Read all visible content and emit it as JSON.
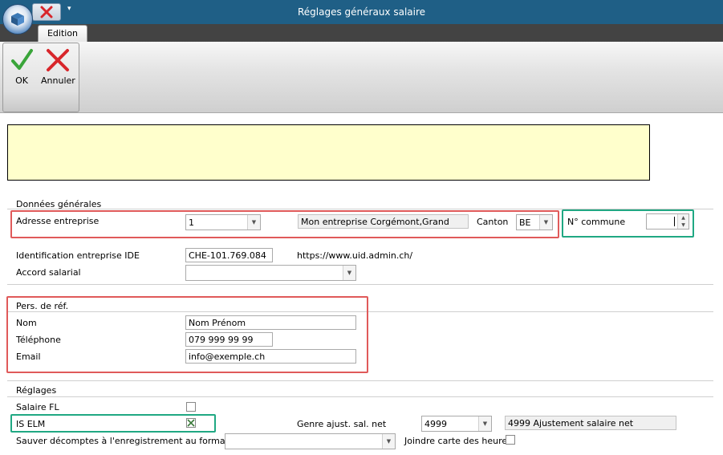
{
  "window": {
    "title": "Réglages généraux salaire"
  },
  "ribbon": {
    "tab_label": "Edition",
    "ok_label": "OK",
    "cancel_label": "Annuler"
  },
  "general": {
    "section_title": "Données générales",
    "company_address_label": "Adresse entreprise",
    "company_address_value": "1",
    "company_name": "Mon entreprise Corgémont,Grand",
    "canton_label": "Canton",
    "canton_value": "BE",
    "commune_label": "N° commune",
    "commune_value": "",
    "ide_label": "Identification entreprise IDE",
    "ide_value": "CHE-101.769.084",
    "ide_link": "https://www.uid.admin.ch/",
    "salary_agreement_label": "Accord salarial",
    "salary_agreement_value": ""
  },
  "reference_person": {
    "section_title": "Pers. de réf.",
    "name_label": "Nom",
    "name_value": "Nom Prénom",
    "phone_label": "Téléphone",
    "phone_value": "079 999 99 99",
    "email_label": "Email",
    "email_value": "info@exemple.ch"
  },
  "settings": {
    "section_title": "Réglages",
    "salaire_fl_label": "Salaire FL",
    "salaire_fl_checked": false,
    "is_elm_label": "IS ELM",
    "is_elm_checked": true,
    "adjust_type_label": "Genre ajust. sal. net",
    "adjust_type_value": "4999",
    "adjust_type_desc": "4999 Ajustement salaire net",
    "save_format_label": "Sauver décomptes à l'enregistrement au format",
    "save_format_value": "",
    "attach_hours_label": "Joindre carte des heures",
    "attach_hours_checked": false
  },
  "colors": {
    "titlebar": "#1f5f86",
    "highlight_red": "#e05a5a",
    "highlight_green": "#20a883",
    "notice_yellow": "#ffffcc"
  }
}
